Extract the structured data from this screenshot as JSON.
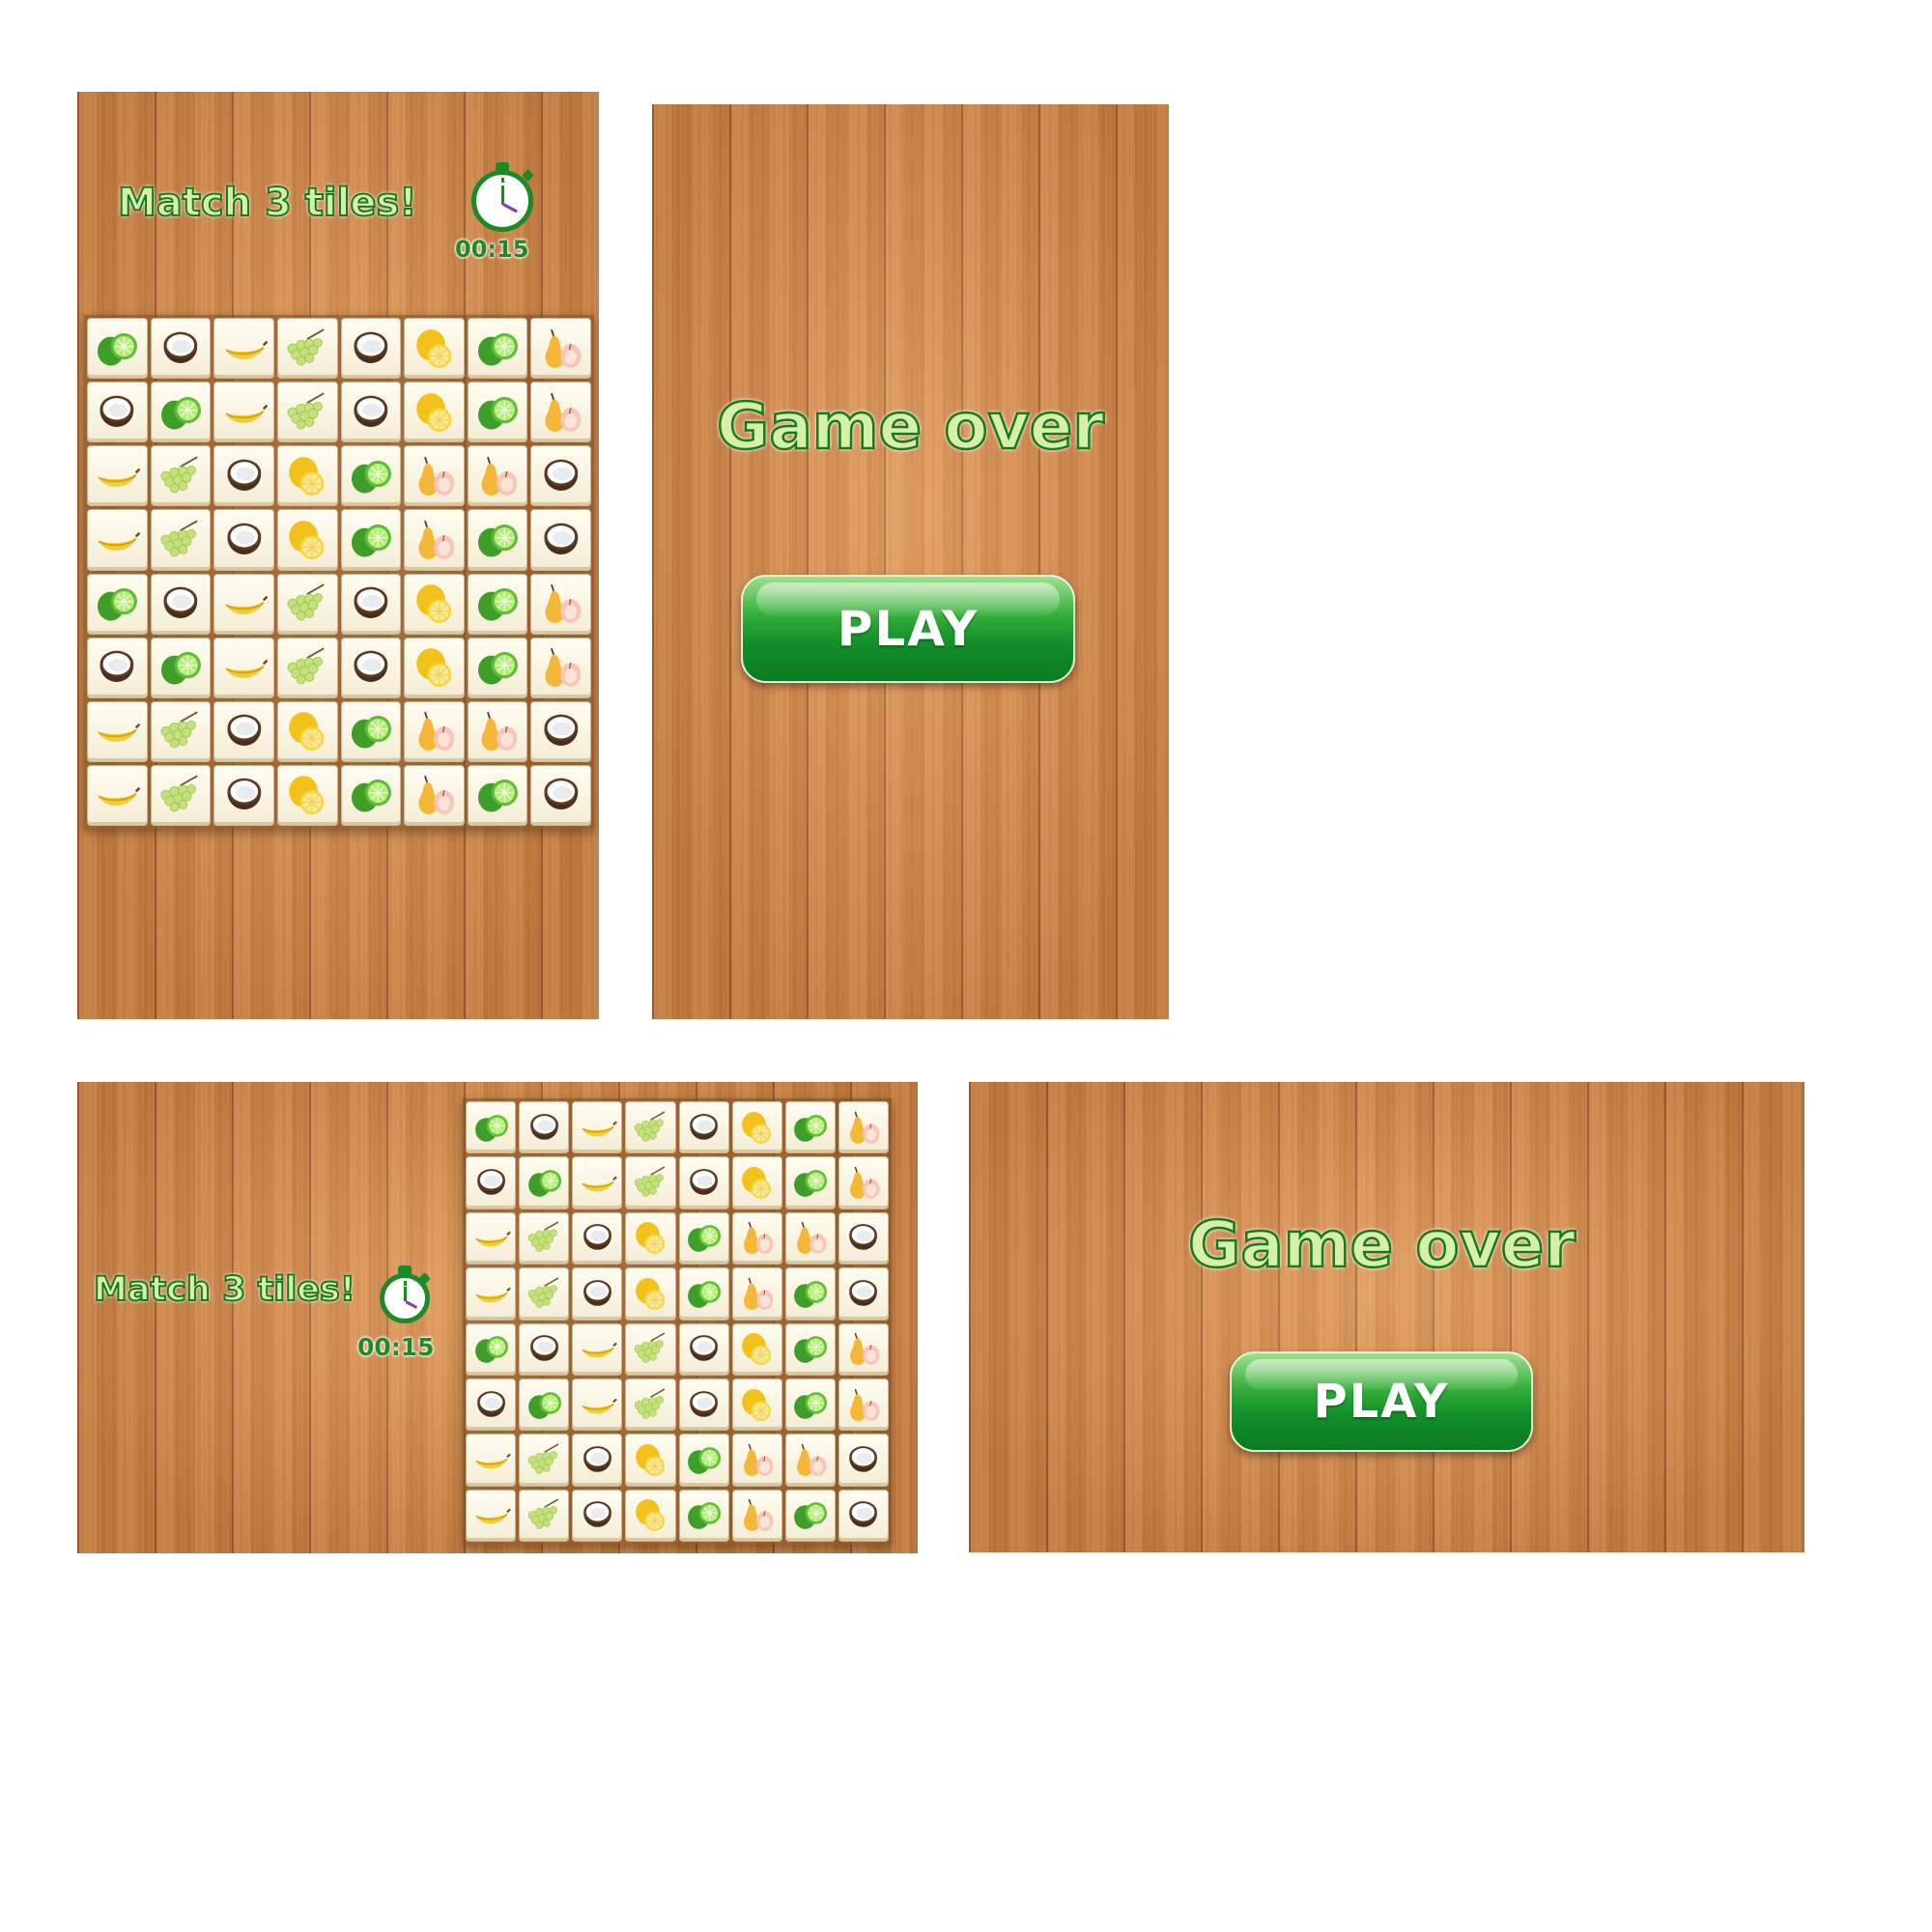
{
  "game": {
    "title": "Match 3 tiles!",
    "timer": "00:15",
    "board_rows": [
      [
        "lime",
        "coconut",
        "banana",
        "grapes",
        "coconut",
        "lemon",
        "lime",
        "pear"
      ],
      [
        "coconut",
        "lime",
        "banana",
        "grapes",
        "coconut",
        "lemon",
        "lime",
        "pear"
      ],
      [
        "banana",
        "grapes",
        "coconut",
        "lemon",
        "lime",
        "pear",
        "pear",
        "coconut"
      ],
      [
        "banana",
        "grapes",
        "coconut",
        "lemon",
        "lime",
        "pear",
        "lime",
        "coconut"
      ],
      [
        "lime",
        "coconut",
        "banana",
        "grapes",
        "coconut",
        "lemon",
        "lime",
        "pear"
      ],
      [
        "coconut",
        "lime",
        "banana",
        "grapes",
        "coconut",
        "lemon",
        "lime",
        "pear"
      ],
      [
        "banana",
        "grapes",
        "coconut",
        "lemon",
        "lime",
        "pear",
        "pear",
        "coconut"
      ],
      [
        "banana",
        "grapes",
        "coconut",
        "lemon",
        "lime",
        "pear",
        "lime",
        "coconut"
      ]
    ]
  },
  "game_over": {
    "title": "Game over",
    "play_label": "PLAY"
  },
  "icons": {
    "stopwatch": "stopwatch-icon",
    "tile_fruits": [
      "lime-icon",
      "coconut-icon",
      "banana-icon",
      "grapes-icon",
      "lemon-icon",
      "pear-icon"
    ]
  },
  "colors": {
    "accent_green": "#1b8a27",
    "title_fill": "#d6f0a8",
    "wood": "#d58a48",
    "tile": "#fffdf2"
  }
}
